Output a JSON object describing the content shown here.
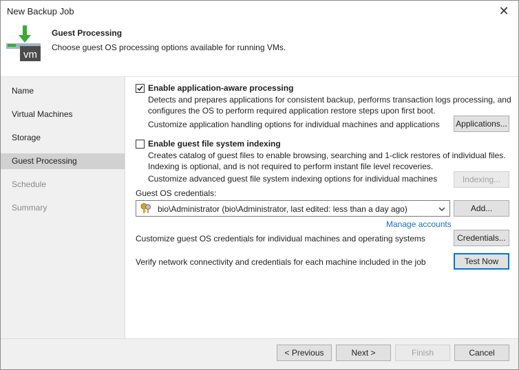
{
  "window": {
    "title": "New Backup Job",
    "close_icon": "close-icon"
  },
  "header": {
    "title": "Guest Processing",
    "subtitle": "Choose guest OS processing options available for running VMs.",
    "icon": "vm-download-icon",
    "icon_label": "vm"
  },
  "sidebar": {
    "items": [
      {
        "label": "Name",
        "state": "normal"
      },
      {
        "label": "Virtual Machines",
        "state": "normal"
      },
      {
        "label": "Storage",
        "state": "normal"
      },
      {
        "label": "Guest Processing",
        "state": "active"
      },
      {
        "label": "Schedule",
        "state": "disabled"
      },
      {
        "label": "Summary",
        "state": "disabled"
      }
    ]
  },
  "app_aware": {
    "checked": true,
    "label": "Enable application-aware processing",
    "desc_line1": "Detects and prepares applications for consistent backup, performs transaction logs processing, and",
    "desc_line2": "configures the OS to perform required application restore steps upon first boot.",
    "customize_text": "Customize application handling options for individual machines and applications",
    "button": "Applications..."
  },
  "indexing": {
    "checked": false,
    "label": "Enable guest file system indexing",
    "desc_line1": "Creates catalog of guest files to enable browsing, searching and 1-click restores of individual files.",
    "desc_line2": "Indexing is optional, and is not required to perform instant file level recoveries.",
    "customize_text": "Customize advanced guest file system indexing options for individual machines",
    "button": "Indexing..."
  },
  "credentials": {
    "label": "Guest OS credentials:",
    "selected": "bio\\Administrator (bio\\Administrator, last edited: less than a day ago)",
    "add_button": "Add...",
    "manage_link": "Manage accounts",
    "customize_text": "Customize guest OS credentials for individual machines and operating systems",
    "credentials_button": "Credentials...",
    "verify_text": "Verify network connectivity and credentials for each machine included in the job",
    "test_button": "Test Now"
  },
  "footer": {
    "previous": "< Previous",
    "next": "Next >",
    "finish": "Finish",
    "cancel": "Cancel"
  },
  "colors": {
    "accent": "#0078d7",
    "link": "#1a6fbf",
    "active_nav": "#d1d1d1",
    "icon_green": "#3aaa35"
  }
}
